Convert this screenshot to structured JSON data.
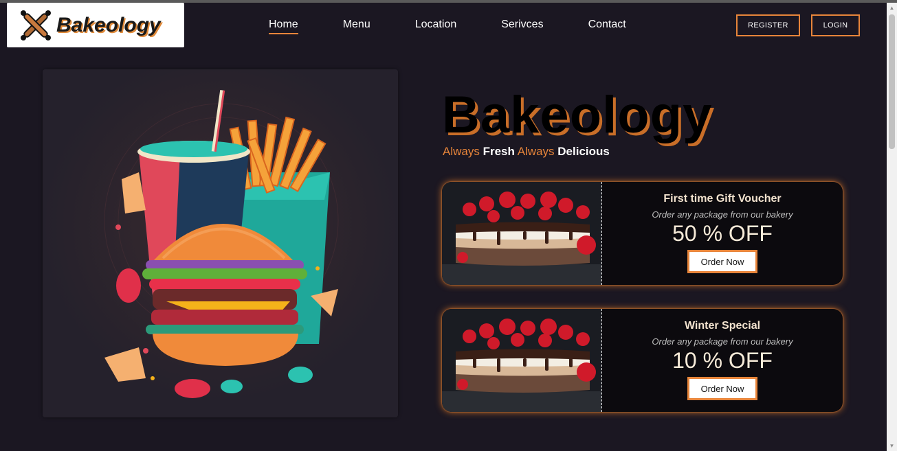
{
  "brand": {
    "logo_text": "Bakeology",
    "icon": "rolling-pin-whisk-icon"
  },
  "nav": {
    "items": [
      {
        "label": "Home",
        "active": true
      },
      {
        "label": "Menu",
        "active": false
      },
      {
        "label": "Location",
        "active": false
      },
      {
        "label": "Serivces",
        "active": false
      },
      {
        "label": "Contact",
        "active": false
      }
    ]
  },
  "auth": {
    "register_label": "REGISTER",
    "login_label": "LOGIN"
  },
  "hero": {
    "image": "burger-fries-drink-illustration",
    "title": "Bakeology",
    "tagline": {
      "w1": "Always",
      "w2": "Fresh",
      "w3": "Always",
      "w4": "Delicious"
    }
  },
  "offers": [
    {
      "title": "First time Gift Voucher",
      "subtitle": "Order any package from our bakery",
      "discount": "50 % OFF",
      "button": "Order Now",
      "image": "strawberry-cheesecake-photo"
    },
    {
      "title": "Winter Special",
      "subtitle": "Order any package from our bakery",
      "discount": "10 % OFF",
      "button": "Order Now",
      "image": "strawberry-cheesecake-photo"
    }
  ],
  "colors": {
    "accent": "#e8853a",
    "background": "#1b1722",
    "card": "#0c0a0e"
  }
}
